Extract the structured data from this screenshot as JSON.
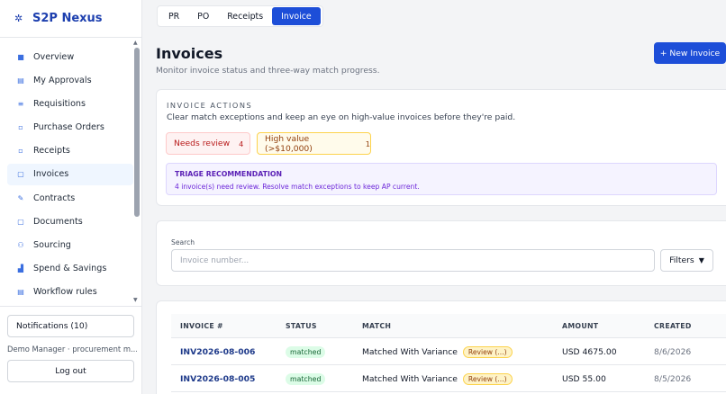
{
  "brand": {
    "name": "S2P Nexus",
    "icon": "sparkle-icon"
  },
  "sidebar": {
    "items": [
      {
        "label": "Overview",
        "icon": "grid-icon",
        "glyph": "■"
      },
      {
        "label": "My Approvals",
        "icon": "clipboard-icon",
        "glyph": "▤"
      },
      {
        "label": "Requisitions",
        "icon": "list-icon",
        "glyph": "≡"
      },
      {
        "label": "Purchase Orders",
        "icon": "po-icon",
        "glyph": "▫"
      },
      {
        "label": "Receipts",
        "icon": "receipt-icon",
        "glyph": "▫"
      },
      {
        "label": "Invoices",
        "icon": "invoice-icon",
        "glyph": "▢",
        "active": true
      },
      {
        "label": "Contracts",
        "icon": "contract-icon",
        "glyph": "✎"
      },
      {
        "label": "Documents",
        "icon": "folder-icon",
        "glyph": "▢"
      },
      {
        "label": "Sourcing",
        "icon": "users-icon",
        "glyph": "⚇"
      },
      {
        "label": "Spend & Savings",
        "icon": "bar-chart-icon",
        "glyph": "▟"
      },
      {
        "label": "Workflow rules",
        "icon": "workflow-icon",
        "glyph": "▤"
      }
    ],
    "notifications_label": "Notifications (10)",
    "user_label": "Demo Manager · procurement m...",
    "logout_label": "Log out"
  },
  "tabs": [
    {
      "label": "PR"
    },
    {
      "label": "PO"
    },
    {
      "label": "Receipts"
    },
    {
      "label": "Invoice",
      "active": true
    }
  ],
  "header": {
    "title": "Invoices",
    "subtitle": "Monitor invoice status and three-way match progress.",
    "new_button": "+ New Invoice"
  },
  "actions": {
    "eyebrow": "INVOICE ACTIONS",
    "description": "Clear match exceptions and keep an eye on high-value invoices before they're paid.",
    "needs_review_label": "Needs review",
    "needs_review_count": "4",
    "high_value_label": "High value (>$10,000)",
    "high_value_count": "1",
    "triage_title": "TRIAGE RECOMMENDATION",
    "triage_body": "4 invoice(s) need review. Resolve match exceptions to keep AP current."
  },
  "search": {
    "label": "Search",
    "placeholder": "Invoice number...",
    "filters_label": "Filters",
    "filters_caret": "▼"
  },
  "table": {
    "columns": [
      "INVOICE #",
      "STATUS",
      "MATCH",
      "AMOUNT",
      "CREATED"
    ],
    "rows": [
      {
        "invoice": "INV2026-08-006",
        "status": "matched",
        "match": "Matched With Variance",
        "flag": "Review (...)",
        "amount": "USD 4675.00",
        "created": "8/6/2026"
      },
      {
        "invoice": "INV2026-08-005",
        "status": "matched",
        "match": "Matched With Variance",
        "flag": "Review (...)",
        "amount": "USD 55.00",
        "created": "8/5/2026"
      }
    ]
  },
  "colors": {
    "primary": "#1d4ed8",
    "brand": "#1e40af",
    "danger": "#b91c1c",
    "warning": "#92400e",
    "purple": "#5b21b6"
  }
}
